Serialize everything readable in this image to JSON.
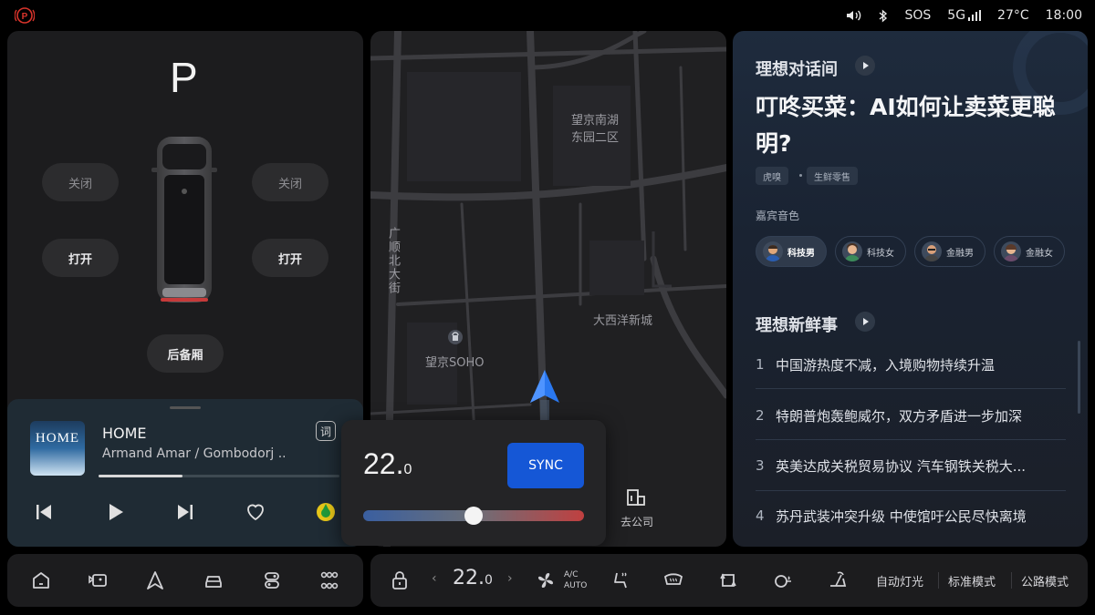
{
  "status": {
    "sos": "SOS",
    "network": "5G",
    "temperature": "27°C",
    "time": "18:00"
  },
  "car": {
    "gear": "P",
    "left_window_top": "关闭",
    "right_window_top": "关闭",
    "left_door": "打开",
    "right_door": "打开",
    "trunk": "后备厢"
  },
  "music": {
    "album_text": "HOME",
    "title": "HOME",
    "artist": "Armand Amar / Gombodorj ...",
    "lyric_button": "词",
    "progress": 0.35
  },
  "map": {
    "labels": {
      "area1_line1": "望京南湖",
      "area1_line2": "东园二区",
      "street": "广顺北大街",
      "poi": "望京SOHO",
      "area2": "大西洋新城"
    },
    "shortcut": "去公司"
  },
  "climate": {
    "temp_int": "22.",
    "temp_dec": "0",
    "sync_label": "SYNC",
    "slider_value": 0.5
  },
  "news": {
    "section1": "理想对话间",
    "headline": "叮咚买菜：AI如何让卖菜更聪明?",
    "tags": [
      "虎嗅",
      "生鲜零售"
    ],
    "voice_label": "嘉宾音色",
    "voices": [
      "科技男",
      "科技女",
      "金融男",
      "金融女"
    ],
    "section2": "理想新鲜事",
    "items": [
      {
        "num": "1",
        "text": "中国游热度不减，入境购物持续升温"
      },
      {
        "num": "2",
        "text": "特朗普炮轰鲍威尔，双方矛盾进一步加深"
      },
      {
        "num": "3",
        "text": "英美达成关税贸易协议 汽车钢铁关税大..."
      },
      {
        "num": "4",
        "text": "苏丹武装冲突升级 中使馆吁公民尽快离境"
      }
    ]
  },
  "dock": {
    "temp_int": "22.",
    "temp_dec": "0",
    "ac_top": "A/C",
    "ac_bottom": "AUTO",
    "auto_light": "自动灯光",
    "standard_mode": "标准模式",
    "road_mode": "公路模式"
  },
  "colors": {
    "accent_blue": "#1557d6",
    "park_red": "#d9342b"
  }
}
